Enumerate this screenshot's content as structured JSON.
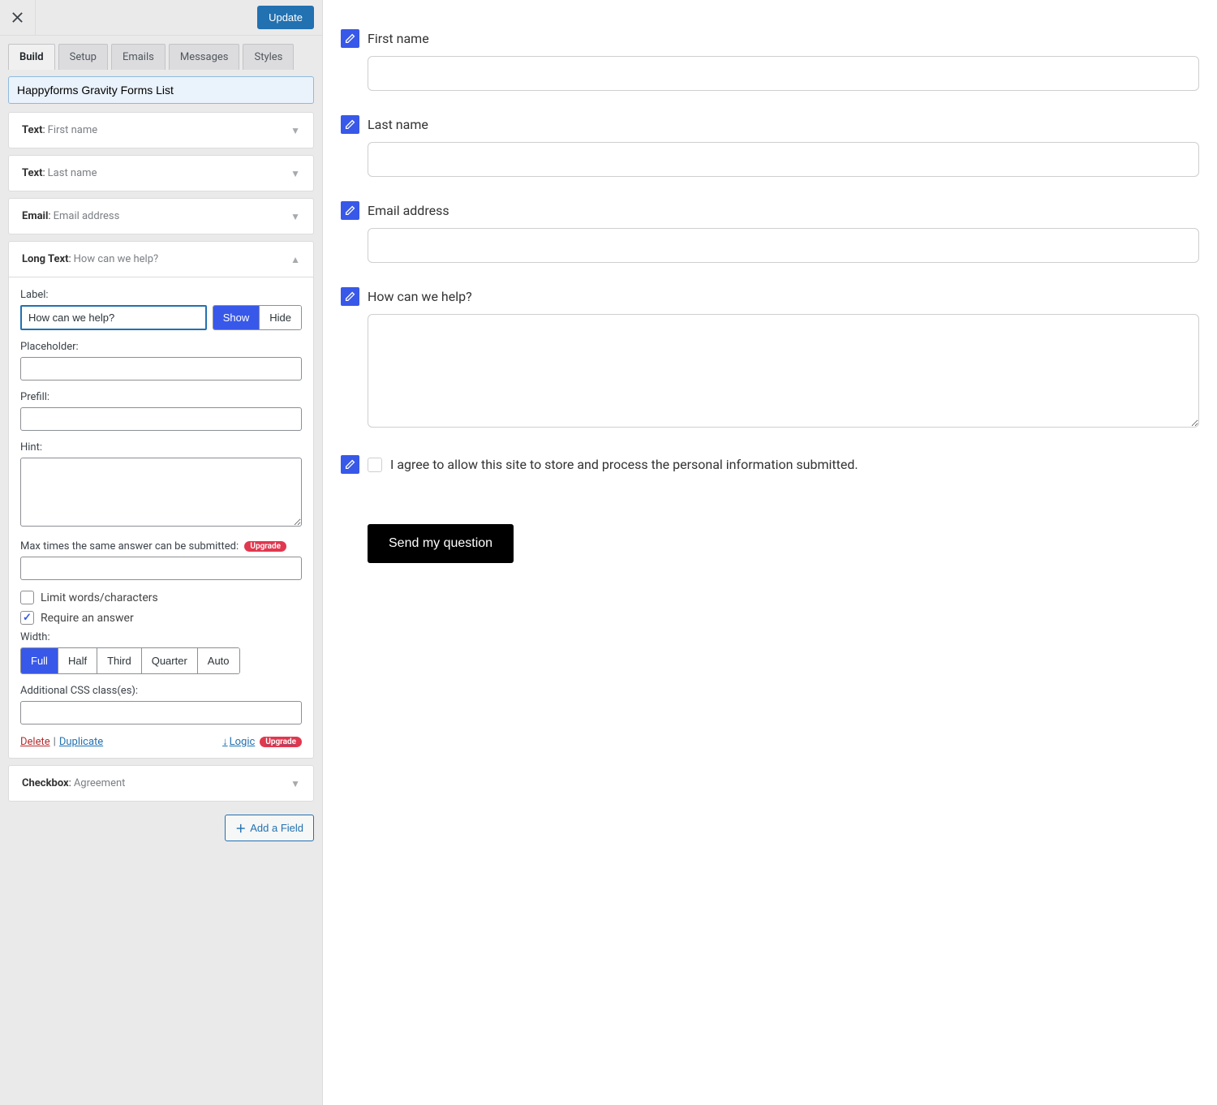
{
  "header": {
    "update": "Update"
  },
  "tabs": [
    "Build",
    "Setup",
    "Emails",
    "Messages",
    "Styles"
  ],
  "active_tab": 0,
  "form_title": "Happyforms Gravity Forms List",
  "fields": [
    {
      "type": "Text",
      "name": "First name"
    },
    {
      "type": "Text",
      "name": "Last name"
    },
    {
      "type": "Email",
      "name": "Email address"
    },
    {
      "type": "Long Text",
      "name": "How can we help?"
    },
    {
      "type": "Checkbox",
      "name": "Agreement"
    }
  ],
  "editor": {
    "label_lbl": "Label:",
    "label_value": "How can we help?",
    "show": "Show",
    "hide": "Hide",
    "placeholder_lbl": "Placeholder:",
    "placeholder_value": "",
    "prefill_lbl": "Prefill:",
    "prefill_value": "",
    "hint_lbl": "Hint:",
    "hint_value": "",
    "max_lbl": "Max times the same answer can be submitted:",
    "upgrade": "Upgrade",
    "max_value": "",
    "limit_lbl": "Limit words/characters",
    "require_lbl": "Require an answer",
    "width_lbl": "Width:",
    "width_options": [
      "Full",
      "Half",
      "Third",
      "Quarter",
      "Auto"
    ],
    "width_active": 0,
    "css_lbl": "Additional CSS class(es):",
    "css_value": "",
    "delete": "Delete",
    "duplicate": "Duplicate",
    "logic": "Logic"
  },
  "add_field": "Add a Field",
  "preview": {
    "consent": "I agree to allow this site to store and process the personal information submitted.",
    "submit": "Send my question"
  }
}
